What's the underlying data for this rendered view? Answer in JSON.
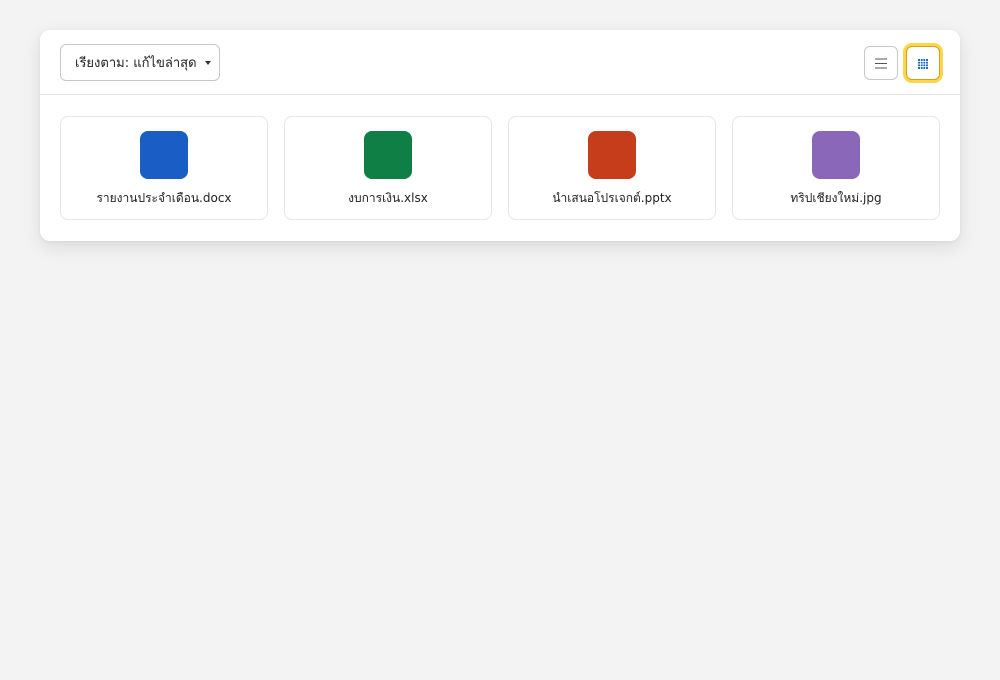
{
  "toolbar": {
    "sort_label": "เรียงตาม: แก้ไขล่าสุด",
    "view_list_icon": "list-icon",
    "view_grid_icon": "grid-icon",
    "active_view": "grid"
  },
  "colors": {
    "accent_focus": "#ffd54a",
    "grid_icon": "#1e6fb8"
  },
  "files": [
    {
      "name": "รายงานประจำเดือน.docx",
      "color": "#1a5dc4",
      "icon": "word-file-icon"
    },
    {
      "name": "งบการเงิน.xlsx",
      "color": "#0f7f45",
      "icon": "excel-file-icon"
    },
    {
      "name": "นำเสนอโปรเจกต์.pptx",
      "color": "#c63d1c",
      "icon": "powerpoint-file-icon"
    },
    {
      "name": "ทริปเชียงใหม่.jpg",
      "color": "#8a67b8",
      "icon": "image-file-icon"
    }
  ]
}
